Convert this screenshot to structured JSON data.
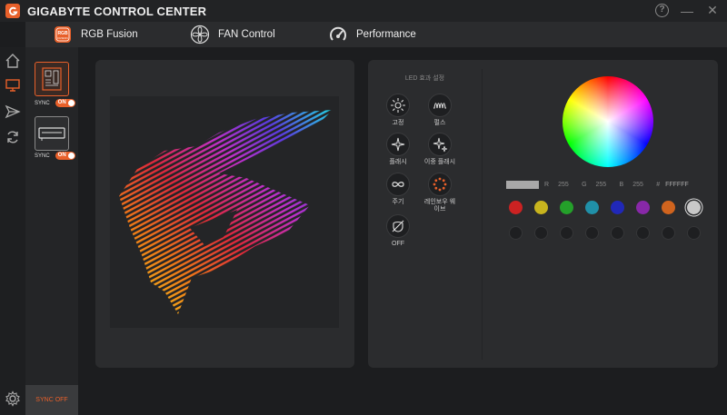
{
  "app": {
    "title": "GIGABYTE CONTROL CENTER"
  },
  "window_controls": {
    "help": "?",
    "minimize": "—",
    "close": "✕"
  },
  "nav": {
    "tabs": [
      {
        "label": "RGB Fusion",
        "icon": "rgb-fusion-icon"
      },
      {
        "label": "FAN Control",
        "icon": "fan-icon"
      },
      {
        "label": "Performance",
        "icon": "performance-gauge-icon"
      }
    ]
  },
  "sidebar": {
    "items": [
      "home-icon",
      "monitor-icon",
      "send-icon",
      "sync-icon",
      "settings-icon"
    ]
  },
  "devices": {
    "items": [
      {
        "name": "motherboard",
        "sync_label": "SYNC",
        "toggle": "ON"
      },
      {
        "name": "graphics-card",
        "sync_label": "SYNC",
        "toggle": "ON"
      }
    ],
    "sync_off": "SYNC OFF"
  },
  "effects": {
    "title": "LED 효과 설정",
    "items": [
      {
        "label": "고정",
        "icon": "static-sun-icon"
      },
      {
        "label": "펄스",
        "icon": "pulse-wave-icon"
      },
      {
        "label": "플래시",
        "icon": "flash-icon"
      },
      {
        "label": "이중 플래시",
        "icon": "double-flash-icon"
      },
      {
        "label": "주기",
        "icon": "cycle-icon"
      },
      {
        "label": "레인보우 웨이브",
        "icon": "rainbow-wave-icon"
      },
      {
        "label": "OFF",
        "icon": "off-icon"
      }
    ]
  },
  "color": {
    "r_label": "R",
    "r_value": "255",
    "g_label": "G",
    "g_value": "255",
    "b_label": "B",
    "b_value": "255",
    "hex_label": "#",
    "hex_value": "FFFFFF",
    "presets": [
      "#cc2222",
      "#c8b41e",
      "#24a02a",
      "#2090a8",
      "#2028b8",
      "#8828a8",
      "#d0641e",
      "#c8c8c8"
    ]
  }
}
